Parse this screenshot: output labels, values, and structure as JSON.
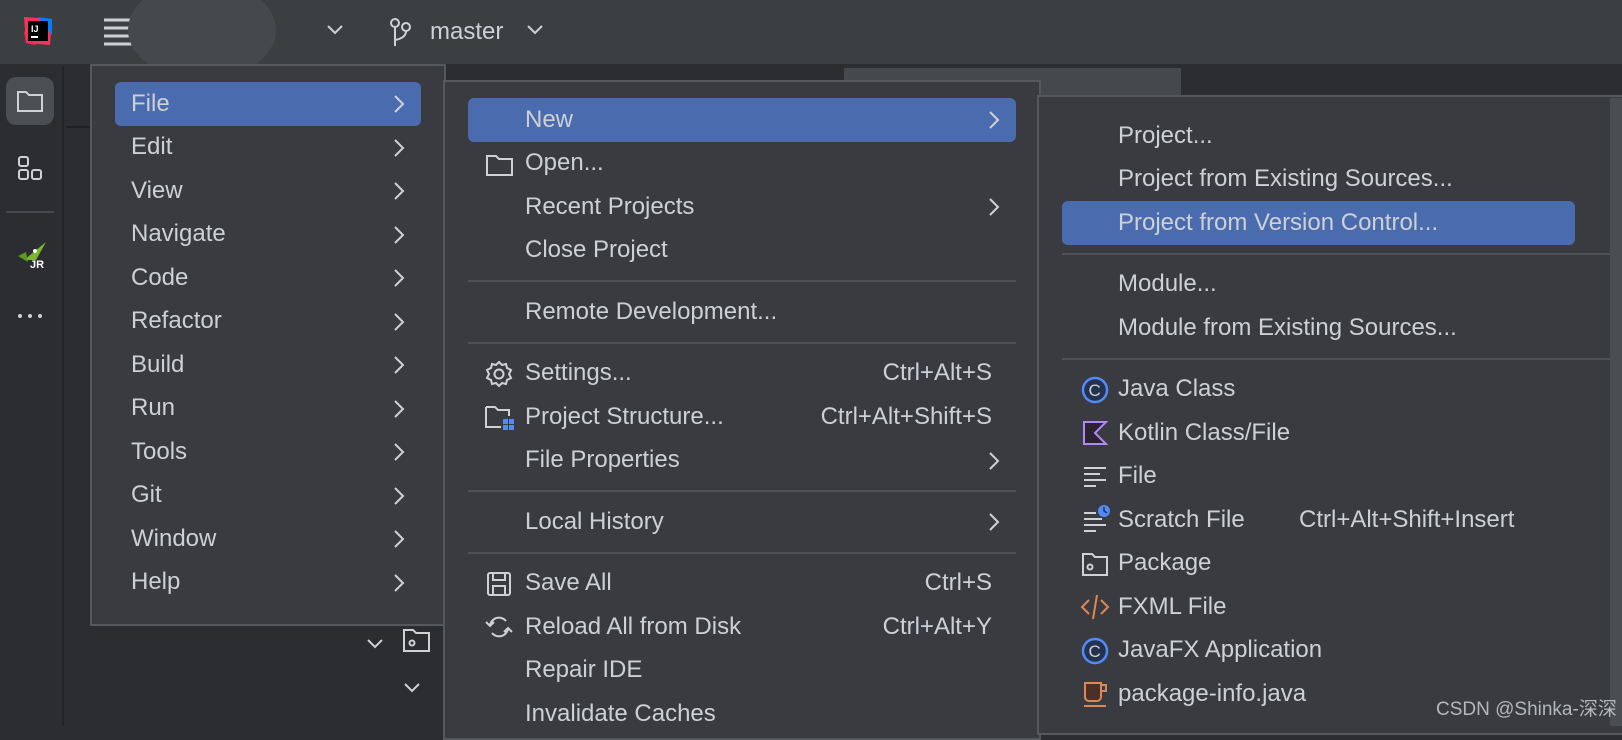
{
  "topbar": {
    "branch": "master",
    "icons": [
      "intellij-logo-icon",
      "hamburger-menu-icon",
      "project-selector-chevron-icon",
      "git-branch-icon",
      "branch-chevron-icon"
    ]
  },
  "sidebar": {
    "icons": [
      "project-folder-icon",
      "structure-icon",
      "jrebel-icon",
      "more-icon"
    ],
    "jrebel_label": "JR"
  },
  "menu1": {
    "items": [
      {
        "label": "File",
        "selected": true,
        "submenu": true
      },
      {
        "label": "Edit",
        "submenu": true
      },
      {
        "label": "View",
        "submenu": true
      },
      {
        "label": "Navigate",
        "submenu": true
      },
      {
        "label": "Code",
        "submenu": true
      },
      {
        "label": "Refactor",
        "submenu": true
      },
      {
        "label": "Build",
        "submenu": true
      },
      {
        "label": "Run",
        "submenu": true
      },
      {
        "label": "Tools",
        "submenu": true
      },
      {
        "label": "Git",
        "submenu": true
      },
      {
        "label": "Window",
        "submenu": true
      },
      {
        "label": "Help",
        "submenu": true
      }
    ]
  },
  "menu2": {
    "items": [
      {
        "label": "New",
        "selected": true,
        "submenu": true
      },
      {
        "label": "Open...",
        "icon": "folder-icon"
      },
      {
        "label": "Recent Projects",
        "submenu": true
      },
      {
        "label": "Close Project"
      },
      {
        "separator": true
      },
      {
        "label": "Remote Development..."
      },
      {
        "separator": true
      },
      {
        "label": "Settings...",
        "icon": "gear-icon",
        "shortcut": "Ctrl+Alt+S"
      },
      {
        "label": "Project Structure...",
        "icon": "project-structure-icon",
        "shortcut": "Ctrl+Alt+Shift+S"
      },
      {
        "label": "File Properties",
        "submenu": true
      },
      {
        "separator": true
      },
      {
        "label": "Local History",
        "submenu": true
      },
      {
        "separator": true
      },
      {
        "label": "Save All",
        "icon": "save-icon",
        "shortcut": "Ctrl+S"
      },
      {
        "label": "Reload All from Disk",
        "icon": "reload-icon",
        "shortcut": "Ctrl+Alt+Y"
      },
      {
        "label": "Repair IDE"
      },
      {
        "label": "Invalidate Caches"
      }
    ]
  },
  "menu3": {
    "items": [
      {
        "label": "Project..."
      },
      {
        "label": "Project from Existing Sources..."
      },
      {
        "label": "Project from Version Control...",
        "selected": true
      },
      {
        "separator": true
      },
      {
        "label": "Module..."
      },
      {
        "label": "Module from Existing Sources..."
      },
      {
        "separator": true
      },
      {
        "label": "Java Class",
        "icon": "java-class-icon"
      },
      {
        "label": "Kotlin Class/File",
        "icon": "kotlin-icon"
      },
      {
        "label": "File",
        "icon": "text-file-icon"
      },
      {
        "label": "Scratch File",
        "icon": "scratch-file-icon",
        "shortcut": "Ctrl+Alt+Shift+Insert"
      },
      {
        "label": "Package",
        "icon": "package-icon"
      },
      {
        "label": "FXML File",
        "icon": "fxml-icon"
      },
      {
        "label": "JavaFX Application",
        "icon": "java-class-icon"
      },
      {
        "label": "package-info.java",
        "icon": "package-info-icon"
      }
    ]
  },
  "colors": {
    "selection": "#4a6cae",
    "menu_bg": "#393b40",
    "text": "#cdd0d5"
  },
  "watermark": "CSDN @Shinka-深深"
}
